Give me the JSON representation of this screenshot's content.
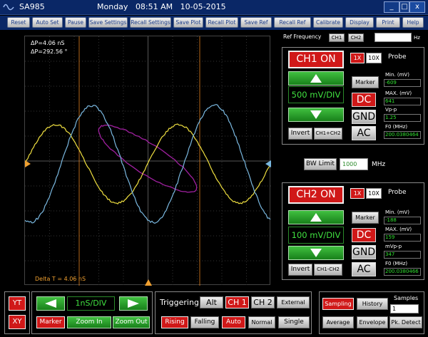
{
  "window": {
    "app_name": "SA985",
    "day": "Monday",
    "time": "08:51 AM",
    "date": "10-05-2015",
    "minimize": "_",
    "maximize": "□",
    "close": "x"
  },
  "toolbar": [
    "Reset",
    "Auto Set",
    "Pause",
    "Save Settings",
    "Recall Settings",
    "Save Plot",
    "Recall Plot",
    "Save Ref",
    "Recall Ref",
    "Calibrate",
    "Display",
    "Print",
    "Help"
  ],
  "measurements": {
    "delta_p_time": "ΔP=4.06  nS",
    "delta_p_phase": "ΔP=292.56 °",
    "delta_t": "Delta T = 4.06 nS"
  },
  "reference": {
    "label": "Ref Frequency",
    "ch1": "CH1",
    "ch2": "CH2",
    "value": "",
    "unit": "Hz"
  },
  "ch1": {
    "state": "CH1 ON",
    "probe_1x": "1X",
    "probe_10x": "10X",
    "probe_label": "Probe",
    "volts_div": "500 mV/DIV",
    "marker": "Marker",
    "invert": "Invert",
    "math": "CH1+CH2",
    "dc": "DC",
    "gnd": "GND",
    "ac": "AC",
    "min_label": "Min. (mV)",
    "min_value": "-609",
    "max_label": "MAX. (mV)",
    "max_value": "641",
    "vpp_label": "Vp-p",
    "vpp_value": "1.25",
    "f0_label": "F0 (MHz)",
    "f0_value": "200.0380464"
  },
  "bandwidth": {
    "label": "BW Limit",
    "value": "1000",
    "unit": "MHz"
  },
  "ch2": {
    "state": "CH2 ON",
    "probe_1x": "1X",
    "probe_10x": "10X",
    "probe_label": "Probe",
    "volts_div": "100 mV/DIV",
    "marker": "Marker",
    "invert": "Invert",
    "math": "CH1-CH2",
    "dc": "DC",
    "gnd": "GND",
    "ac": "AC",
    "min_label": "Min. (mV)",
    "min_value": "-188",
    "max_label": "MAX. (mV)",
    "max_value": "159",
    "vpp_label": "mVp-p",
    "vpp_value": "347",
    "f0_label": "F0 (MHz)",
    "f0_value": "200.0380466"
  },
  "display_mode": {
    "yt": "YT",
    "xy": "XY"
  },
  "timebase": {
    "time_div": "1nS/DIV",
    "marker": "Marker",
    "zoom_in": "Zoom In",
    "zoom_out": "Zoom Out"
  },
  "triggering": {
    "label": "Triggering",
    "alt": "Alt",
    "ch1": "CH 1",
    "ch2": "CH 2",
    "external": "External",
    "rising": "Rising",
    "falling": "Falling",
    "auto": "Auto",
    "normal": "Normal",
    "single": "Single"
  },
  "acquisition": {
    "sampling": "Sampling",
    "history": "History",
    "samples_label": "Samples",
    "samples_value": "1",
    "average": "Average",
    "envelope": "Envelope",
    "peak_detect": "Pk. Detect"
  },
  "colors": {
    "ch1_trace": "#f0e040",
    "ch2_trace": "#7ab8e0",
    "xy_trace": "#a020a0",
    "cursor": "#e08020",
    "active_red": "#d01818",
    "value_green": "#30e030"
  }
}
